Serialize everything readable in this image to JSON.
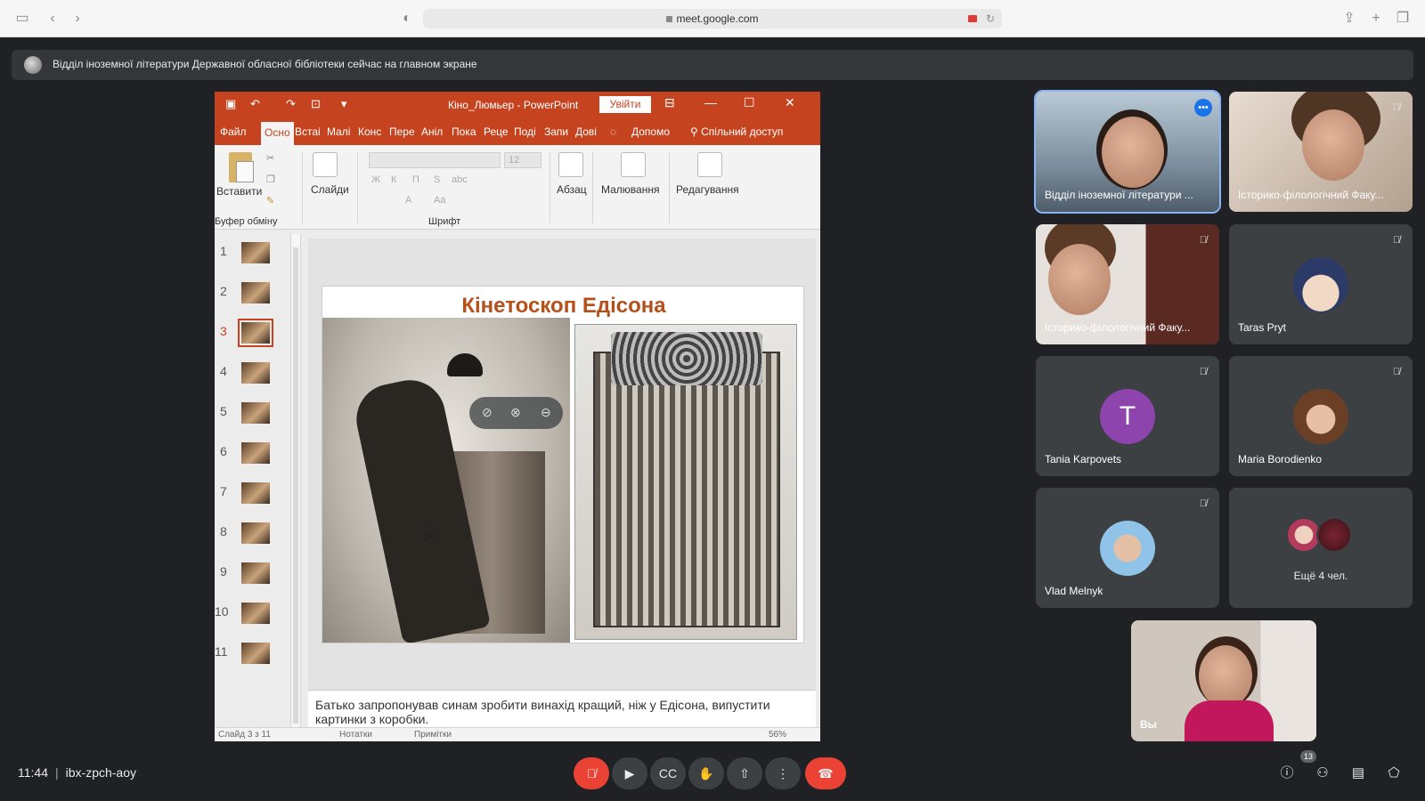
{
  "browser": {
    "url": "meet.google.com",
    "icons": [
      "sidebar-icon",
      "back-icon",
      "forward-icon",
      "shield-icon",
      "lock-icon",
      "camera-icon",
      "reload-icon",
      "share-icon",
      "new-tab-icon",
      "tabs-icon"
    ]
  },
  "banner": {
    "text": "Відділ іноземної літератури Державної обласної бібліотеки сейчас на главном экране"
  },
  "ppt": {
    "doc_title": "Кіно_Люмьер  -  PowerPoint",
    "signin_label": "Увійти",
    "menu": [
      "Файл",
      "Осно",
      "Встаі",
      "Малі",
      "Конс",
      "Пере",
      "Аніл",
      "Пока",
      "Реце",
      "Поді",
      "Запи",
      "Дові"
    ],
    "help_label": "Допомо",
    "share_label": "Спільний доступ",
    "ribbon": {
      "paste": "Вставити",
      "clipboard": "Буфер обміну",
      "slides": "Слайди",
      "font_group": "Шрифт",
      "font_size": "12",
      "paragraph": "Абзац",
      "drawing": "Малювання",
      "editing": "Редагування",
      "format_buttons": [
        "Ж",
        "К",
        "П",
        "S",
        "abc",
        "A",
        "Aa"
      ]
    },
    "slide_numbers": [
      "1",
      "2",
      "3",
      "4",
      "5",
      "6",
      "7",
      "8",
      "9",
      "10",
      "11"
    ],
    "selected_slide": "3",
    "slide_title": "Кінетоскоп Едісона",
    "notes": "Батько запропонував синам зробити винахід кращий, ніж у Едісона, випустити картинки з коробки.",
    "status": {
      "slide_counter": "Слайд 3 з 11",
      "notes_btn": "Нотатки",
      "comments_btn": "Примітки",
      "zoom": "56%"
    }
  },
  "participants": [
    {
      "name": "Відділ іноземної літератури ...",
      "muted": false,
      "speaking": true
    },
    {
      "name": "Історико-філологічний Факу...",
      "muted": true
    },
    {
      "name": "Історико-філологічний Факу...",
      "muted": true
    },
    {
      "name": "Taras Pryt",
      "muted": true
    },
    {
      "name": "Tania Karpovets",
      "muted": true,
      "initial": "T"
    },
    {
      "name": "Maria Borodienko",
      "muted": true
    },
    {
      "name": "Vlad Melnyk",
      "muted": true
    },
    {
      "name": "",
      "more_label": "Ещё 4 чел."
    }
  ],
  "self_tile": {
    "name": "Вы",
    "muted": true
  },
  "meeting": {
    "time": "11:44",
    "code": "ibx-zpch-aoy",
    "participant_count": "13"
  },
  "colors": {
    "ppt_accent": "#c5441f",
    "end_call": "#ea4335",
    "tania_avatar": "#8e44ad",
    "speaking_outline": "#8ab4f8"
  }
}
